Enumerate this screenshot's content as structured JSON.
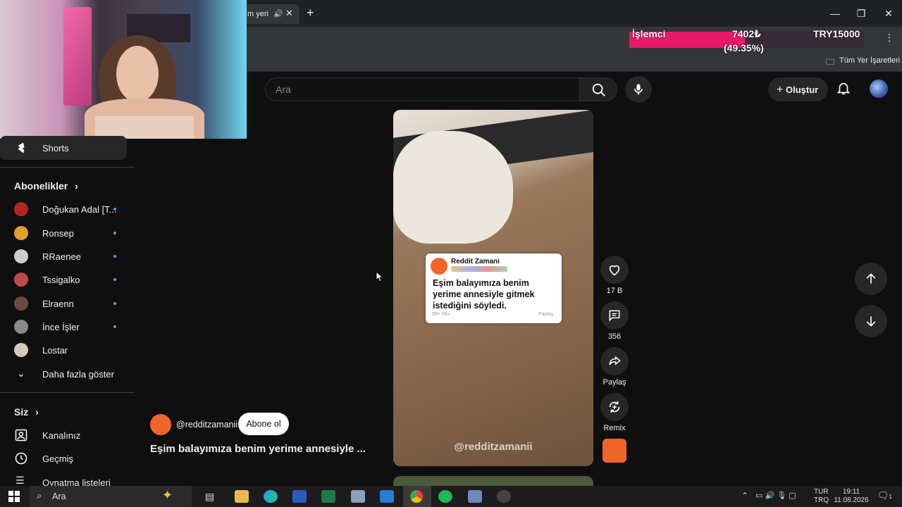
{
  "browser": {
    "tab_title": "m yeri",
    "new_tab": "+",
    "bookmarks_all": "Tüm Yer İşaretleri"
  },
  "donation": {
    "label": "İşlemci",
    "amount": "7402₺",
    "percent": "(49.35%)",
    "goal": "TRY15000",
    "progress": 0.4935
  },
  "header": {
    "search_placeholder": "Ara",
    "create_label": "Oluştur"
  },
  "sidebar": {
    "shorts": "Shorts",
    "subscriptions_title": "Abonelikler",
    "subscriptions": [
      {
        "name": "Doğukan Adal [T...",
        "color": "#b3261e"
      },
      {
        "name": "Ronsep",
        "color": "#e0a030"
      },
      {
        "name": "RRaenee",
        "color": "#cccccc"
      },
      {
        "name": "Tssigalko",
        "color": "#c04a4a"
      },
      {
        "name": "Elraenn",
        "color": "#6a4a3a"
      },
      {
        "name": "İnce İşler",
        "color": "#888888"
      },
      {
        "name": "Lostar",
        "color": "#d8c8b8"
      }
    ],
    "show_more": "Daha fazla göster",
    "you_title": "Siz",
    "you_items": [
      "Kanalınız",
      "Geçmiş",
      "Oynatma listeleri"
    ]
  },
  "video": {
    "card_account": "Reddit Zamani",
    "card_title": "Eşim balayımıza benim yerime annesiyle gitmek istediğini söyledi.",
    "card_share": "Paylaş",
    "card_stats": "99+   99+",
    "watermark": "@redditzamanii",
    "channel": "@redditzamanii",
    "subscribe": "Abone ol",
    "title": "Eşim balayımıza benim yerime annesiyle ..."
  },
  "actions": {
    "likes": "17 B",
    "comments": "356",
    "share": "Paylaş",
    "remix": "Remix"
  },
  "taskbar": {
    "search": "Ara",
    "lang_top": "TUR",
    "lang_bottom": "TRQ",
    "time": "19:11",
    "date": "11.08.2026",
    "notifications": "1"
  }
}
